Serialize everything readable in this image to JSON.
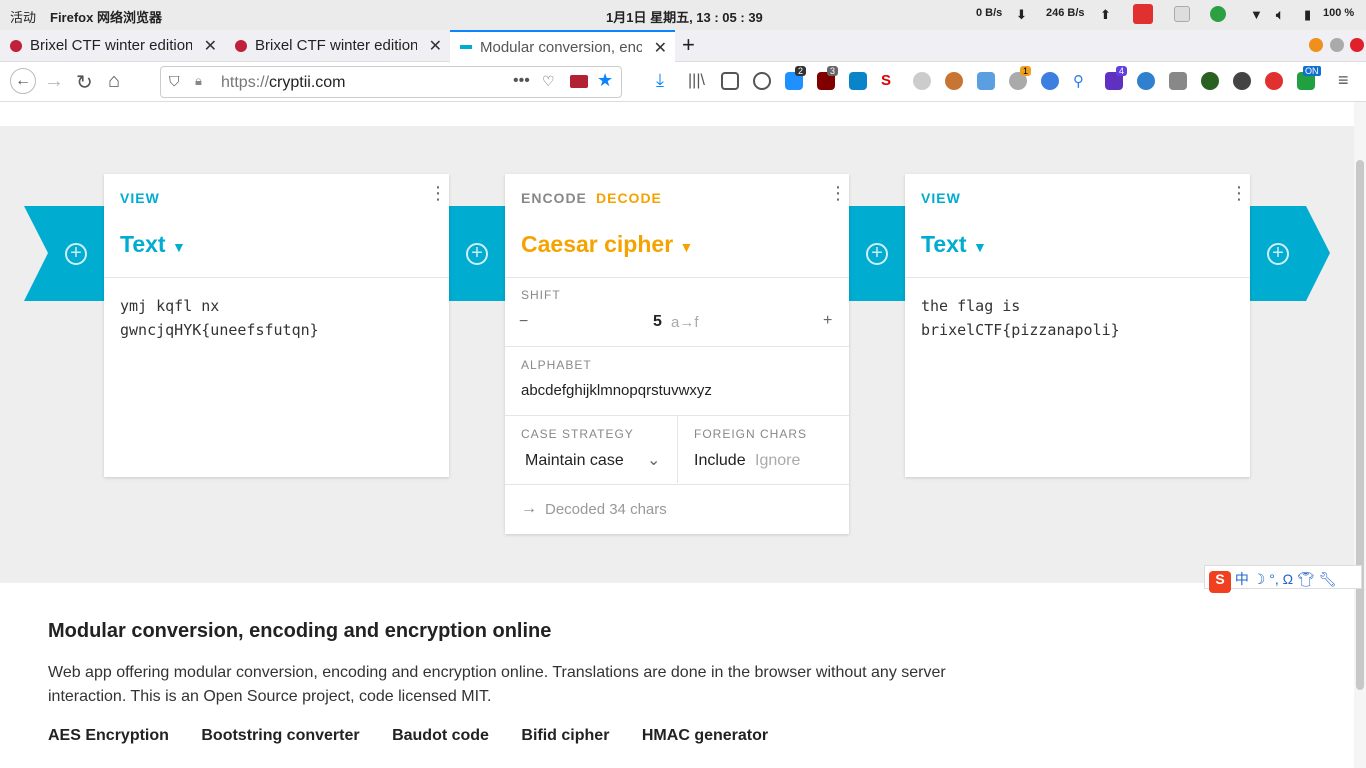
{
  "system": {
    "activities": "活动",
    "app_name": "Firefox 网络浏览器",
    "clock": "1月1日 星期五, 13 : 05 : 39",
    "net_down": "0 B/s",
    "net_up": "246 B/s",
    "battery": "100 %"
  },
  "tabs": [
    {
      "label": "Brixel CTF winter edition",
      "active": false
    },
    {
      "label": "Brixel CTF winter edition",
      "active": false
    },
    {
      "label": "Modular conversion, enc",
      "active": true
    }
  ],
  "url": {
    "scheme": "https://",
    "host": "cryptii.com"
  },
  "badges": {
    "b1": "2",
    "b2": "3",
    "b3": "1",
    "b4": "4",
    "b5": "ON"
  },
  "left_card": {
    "mode": "VIEW",
    "title": "Text",
    "content": "ymj kqfl nx\ngwncjqHYK{uneefsfutqn}"
  },
  "middle_card": {
    "mode_encode": "ENCODE",
    "mode_decode": "DECODE",
    "title": "Caesar cipher",
    "shift_label": "SHIFT",
    "shift_minus": "−",
    "shift_value": "5",
    "shift_hint": "a→f",
    "shift_plus": "+",
    "alphabet_label": "ALPHABET",
    "alphabet_value": "abcdefghijklmnopqrstuvwxyz",
    "case_label": "CASE STRATEGY",
    "case_value": "Maintain case",
    "foreign_label": "FOREIGN CHARS",
    "foreign_include": "Include",
    "foreign_ignore": "Ignore",
    "status": "Decoded 34 chars"
  },
  "right_card": {
    "mode": "VIEW",
    "title": "Text",
    "content": "the flag is\nbrixelCTF{pizzanapoli}"
  },
  "footer": {
    "heading": "Modular conversion, encoding and encryption online",
    "description": "Web app offering modular conversion, encoding and encryption online. Translations are done in the browser without any server interaction. This is an Open Source project, code licensed MIT.",
    "links": [
      "AES Encryption",
      "Bootstring converter",
      "Baudot code",
      "Bifid cipher",
      "HMAC generator"
    ]
  },
  "ime": {
    "logo": "S",
    "mode": "中"
  },
  "colors": {
    "accent": "#00acd0",
    "orange": "#f5a300"
  }
}
